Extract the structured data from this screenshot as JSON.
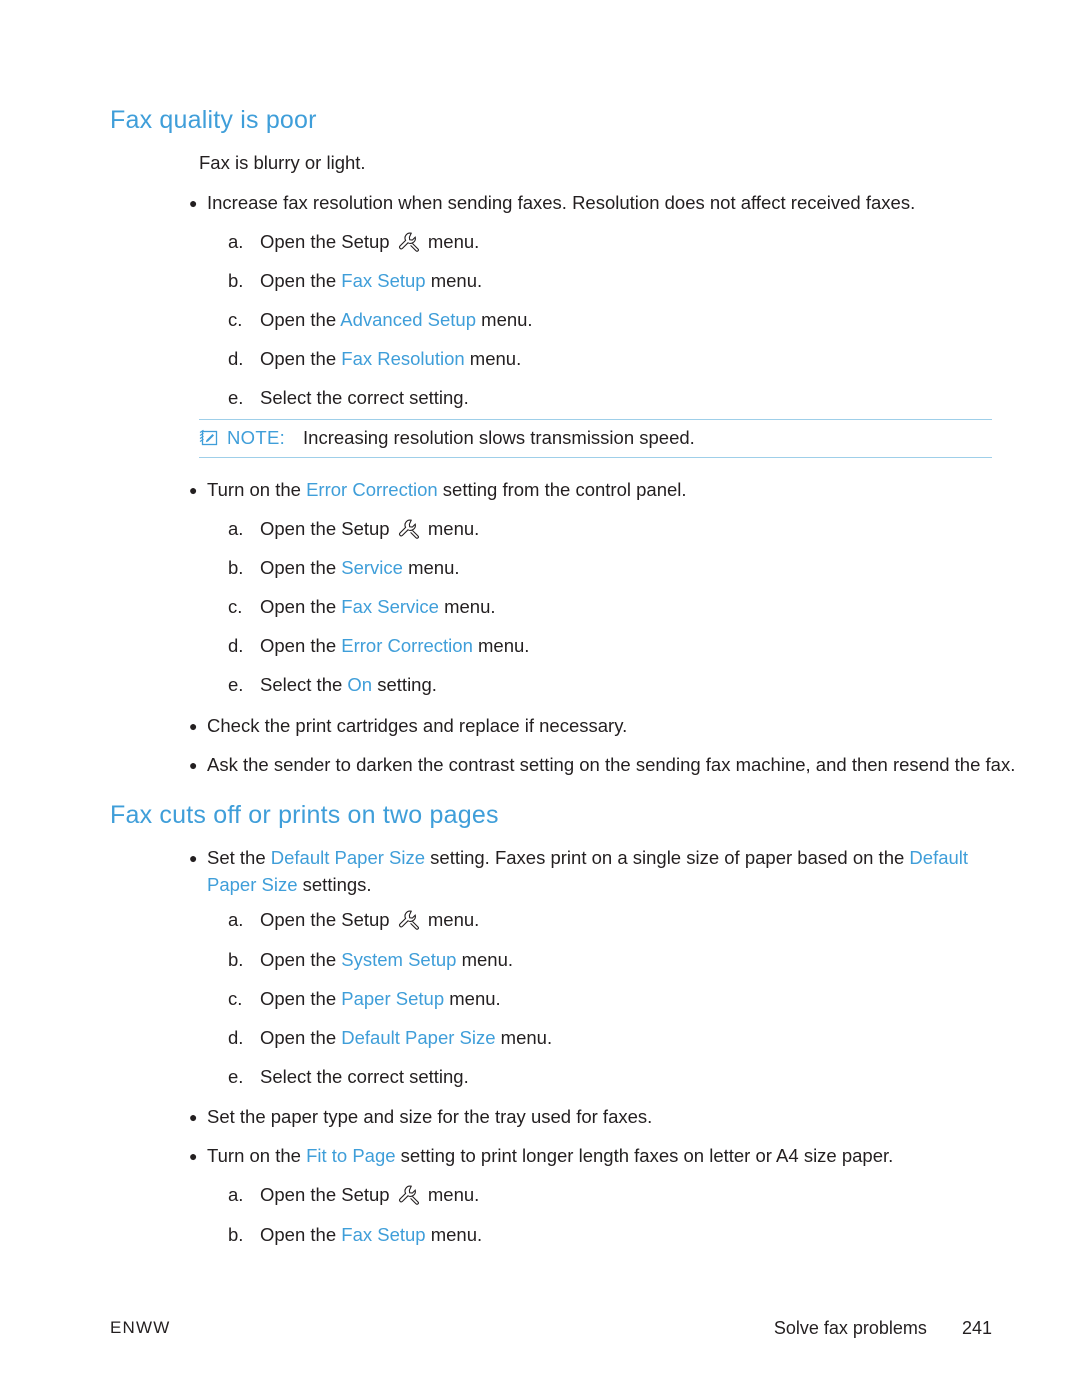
{
  "document": {
    "sections": [
      {
        "title": "Fax quality is poor",
        "intro": "Fax is blurry or light.",
        "bullets": [
          {
            "text_parts": [
              {
                "t": "Increase fax resolution when sending faxes. Resolution does not affect received faxes.",
                "blue": false
              }
            ],
            "steps": [
              {
                "letter": "a.",
                "parts": [
                  {
                    "t": "Open the Setup ",
                    "blue": false
                  },
                  {
                    "t": "icon:wrench",
                    "blue": false
                  },
                  {
                    "t": " menu.",
                    "blue": false
                  }
                ]
              },
              {
                "letter": "b.",
                "parts": [
                  {
                    "t": "Open the ",
                    "blue": false
                  },
                  {
                    "t": "Fax Setup",
                    "blue": true
                  },
                  {
                    "t": " menu.",
                    "blue": false
                  }
                ]
              },
              {
                "letter": "c.",
                "parts": [
                  {
                    "t": "Open the ",
                    "blue": false
                  },
                  {
                    "t": "Advanced Setup",
                    "blue": true
                  },
                  {
                    "t": " menu.",
                    "blue": false
                  }
                ]
              },
              {
                "letter": "d.",
                "parts": [
                  {
                    "t": "Open the ",
                    "blue": false
                  },
                  {
                    "t": "Fax Resolution",
                    "blue": true
                  },
                  {
                    "t": " menu.",
                    "blue": false
                  }
                ]
              },
              {
                "letter": "e.",
                "parts": [
                  {
                    "t": "Select the correct setting.",
                    "blue": false
                  }
                ]
              }
            ]
          },
          {
            "text_parts": [
              {
                "t": "Turn on the ",
                "blue": false
              },
              {
                "t": "Error Correction",
                "blue": true
              },
              {
                "t": " setting from the control panel.",
                "blue": false
              }
            ],
            "steps": [
              {
                "letter": "a.",
                "parts": [
                  {
                    "t": "Open the Setup ",
                    "blue": false
                  },
                  {
                    "t": "icon:wrench",
                    "blue": false
                  },
                  {
                    "t": " menu.",
                    "blue": false
                  }
                ]
              },
              {
                "letter": "b.",
                "parts": [
                  {
                    "t": "Open the ",
                    "blue": false
                  },
                  {
                    "t": "Service",
                    "blue": true
                  },
                  {
                    "t": " menu.",
                    "blue": false
                  }
                ]
              },
              {
                "letter": "c.",
                "parts": [
                  {
                    "t": "Open the ",
                    "blue": false
                  },
                  {
                    "t": "Fax Service",
                    "blue": true
                  },
                  {
                    "t": " menu.",
                    "blue": false
                  }
                ]
              },
              {
                "letter": "d.",
                "parts": [
                  {
                    "t": "Open the ",
                    "blue": false
                  },
                  {
                    "t": "Error Correction",
                    "blue": true
                  },
                  {
                    "t": " menu.",
                    "blue": false
                  }
                ]
              },
              {
                "letter": "e.",
                "parts": [
                  {
                    "t": "Select the ",
                    "blue": false
                  },
                  {
                    "t": "On",
                    "blue": true
                  },
                  {
                    "t": " setting.",
                    "blue": false
                  }
                ]
              }
            ]
          },
          {
            "text_parts": [
              {
                "t": "Check the print cartridges and replace if necessary.",
                "blue": false
              }
            ],
            "steps": []
          },
          {
            "text_parts": [
              {
                "t": "Ask the sender to darken the contrast setting on the sending fax machine, and then resend the fax.",
                "blue": false
              }
            ],
            "steps": []
          }
        ],
        "note": {
          "label": "NOTE:",
          "text": "Increasing resolution slows transmission speed."
        }
      },
      {
        "title": "Fax cuts off or prints on two pages",
        "bullets": [
          {
            "text_parts": [
              {
                "t": "Set the ",
                "blue": false
              },
              {
                "t": "Default Paper Size",
                "blue": true
              },
              {
                "t": " setting. Faxes print on a single size of paper based on the ",
                "blue": false
              },
              {
                "t": "Default Paper Size",
                "blue": true
              },
              {
                "t": " settings.",
                "blue": false
              }
            ],
            "steps": [
              {
                "letter": "a.",
                "parts": [
                  {
                    "t": "Open the Setup ",
                    "blue": false
                  },
                  {
                    "t": "icon:wrench",
                    "blue": false
                  },
                  {
                    "t": " menu.",
                    "blue": false
                  }
                ]
              },
              {
                "letter": "b.",
                "parts": [
                  {
                    "t": "Open the ",
                    "blue": false
                  },
                  {
                    "t": "System Setup",
                    "blue": true
                  },
                  {
                    "t": " menu.",
                    "blue": false
                  }
                ]
              },
              {
                "letter": "c.",
                "parts": [
                  {
                    "t": "Open the ",
                    "blue": false
                  },
                  {
                    "t": "Paper Setup",
                    "blue": true
                  },
                  {
                    "t": " menu.",
                    "blue": false
                  }
                ]
              },
              {
                "letter": "d.",
                "parts": [
                  {
                    "t": "Open the ",
                    "blue": false
                  },
                  {
                    "t": "Default Paper Size",
                    "blue": true
                  },
                  {
                    "t": " menu.",
                    "blue": false
                  }
                ]
              },
              {
                "letter": "e.",
                "parts": [
                  {
                    "t": "Select the correct setting.",
                    "blue": false
                  }
                ]
              }
            ]
          },
          {
            "text_parts": [
              {
                "t": "Set the paper type and size for the tray used for faxes.",
                "blue": false
              }
            ],
            "steps": []
          },
          {
            "text_parts": [
              {
                "t": "Turn on the ",
                "blue": false
              },
              {
                "t": "Fit to Page",
                "blue": true
              },
              {
                "t": " setting to print longer length faxes on letter or A4 size paper.",
                "blue": false
              }
            ],
            "steps": [
              {
                "letter": "a.",
                "parts": [
                  {
                    "t": "Open the Setup ",
                    "blue": false
                  },
                  {
                    "t": "icon:wrench",
                    "blue": false
                  },
                  {
                    "t": " menu.",
                    "blue": false
                  }
                ]
              },
              {
                "letter": "b.",
                "parts": [
                  {
                    "t": "Open the ",
                    "blue": false
                  },
                  {
                    "t": "Fax Setup",
                    "blue": true
                  },
                  {
                    "t": " menu.",
                    "blue": false
                  }
                ]
              }
            ]
          }
        ]
      }
    ],
    "footer": {
      "left": "ENWW",
      "right_label": "Solve fax problems",
      "page_number": "241"
    },
    "colors": {
      "accent": "#3f9ed9",
      "text": "#231f20",
      "rule": "#9fcfe9"
    }
  }
}
